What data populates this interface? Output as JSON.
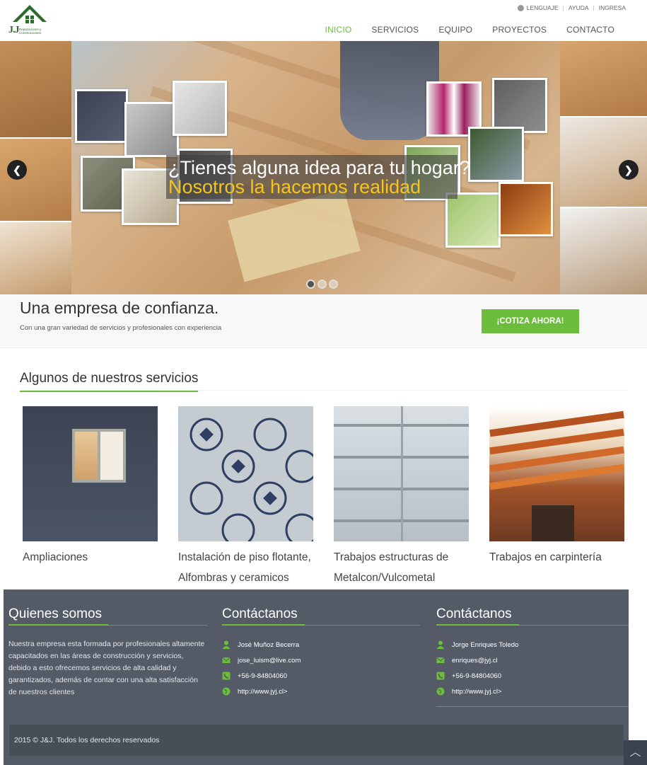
{
  "brand": {
    "logo_letters": "J.J",
    "logo_tagline": "Reparaciones y Construcciones",
    "accent_color": "#6cbd3c"
  },
  "topbar": {
    "items": [
      "LENGUAJE",
      "AYUDA",
      "INGRESA"
    ]
  },
  "nav": {
    "items": [
      "INICIO",
      "SERVICIOS",
      "EQUIPO",
      "PROYECTOS",
      "CONTACTO"
    ],
    "active": "INICIO"
  },
  "hero": {
    "caption_line1": "¿Tienes alguna idea para tu hogar?",
    "caption_line2": "Nosotros la hacemos realidad",
    "prev_icon": "chevron-left-icon",
    "next_icon": "chevron-right-icon",
    "prev_glyph": "❮",
    "next_glyph": "❯",
    "slides": 3,
    "current_slide": 1
  },
  "band": {
    "title": "Una empresa de confianza.",
    "subtitle": "Con una gran variedad de servicios y profesionales con experiencia",
    "cta_label": "¡COTIZA AHORA!"
  },
  "services": {
    "heading": "Algunos de nuestros servicios",
    "items": [
      {
        "label": "Ampliaciones"
      },
      {
        "label": "Instalación de piso flotante, Alfombras y ceramicos"
      },
      {
        "label": "Trabajos estructuras de Metalcon/Vulcometal"
      },
      {
        "label": "Trabajos en carpintería"
      }
    ]
  },
  "footer": {
    "about": {
      "title": "Quienes somos",
      "text": "Nuestra empresa esta formada por profesionales altamente capacitados en las áreas de construcción y servicios, debido a esto ofrecemos servicios de alta calidad y garantizados, además de contar con una alta satisfacción de nuestros clientes"
    },
    "contact1": {
      "title": "Contáctanos",
      "name": "José Muñoz Becerra",
      "email": "jose_luism@live.com",
      "phone": "+56-9-84804060",
      "web": "http://www.jyj.cl>"
    },
    "contact2": {
      "title": "Contáctanos",
      "name": "Jorge Enriques Toledo",
      "email": "enriques@jyj.cl",
      "phone": "+56-9-84804060",
      "web": "http://www.jyj.cl>"
    },
    "copyright": "2015 © J&J. Todos los derechos reservados",
    "to_top_icon": "chevron-up-icon",
    "to_top_glyph": "︿"
  }
}
